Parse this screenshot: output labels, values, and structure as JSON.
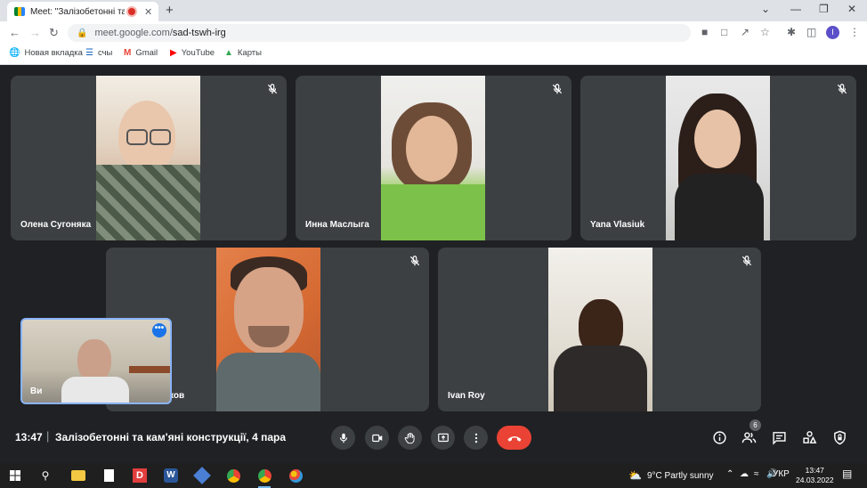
{
  "browser": {
    "tab_title": "Meet: \"Залізобетонні та кам'",
    "tab_close": "✕",
    "new_tab": "+",
    "url_host": "meet.google.com/",
    "url_path": "sad-tswh-irg",
    "profile_initial": "I",
    "window_controls": [
      "⌄",
      "—",
      "❐",
      "✕"
    ],
    "bookmarks": [
      {
        "label": "Новая вкладка",
        "icon": "globe-icon"
      },
      {
        "label": "счы",
        "icon": "flag-icon"
      },
      {
        "label": "Gmail",
        "icon": "gmail-icon"
      },
      {
        "label": "YouTube",
        "icon": "youtube-icon"
      },
      {
        "label": "Карты",
        "icon": "maps-icon"
      }
    ]
  },
  "participants": [
    {
      "name": "Олена Сугоняка",
      "muted": true
    },
    {
      "name": "Инна Маслыга",
      "muted": true
    },
    {
      "name": "Yana Vlasiuk",
      "muted": true
    },
    {
      "name": "ков",
      "muted": true
    },
    {
      "name": "Ivan Roy",
      "muted": true
    }
  ],
  "self_view": {
    "name": "Ви",
    "more_label": "•••"
  },
  "meeting": {
    "time": "13:47",
    "separator": "|",
    "title": "Залізобетонні та кам'яні конструкції, 4 пара",
    "participant_count": "6"
  },
  "taskbar": {
    "weather_temp": "9°C",
    "weather_desc": "Partly sunny",
    "language": "УКР",
    "time": "13:47",
    "date": "24.03.2022"
  },
  "colors": {
    "end_call": "#ea4335",
    "accent": "#1a73e8",
    "tile_bg": "#3c4043",
    "page_bg": "#202124"
  }
}
